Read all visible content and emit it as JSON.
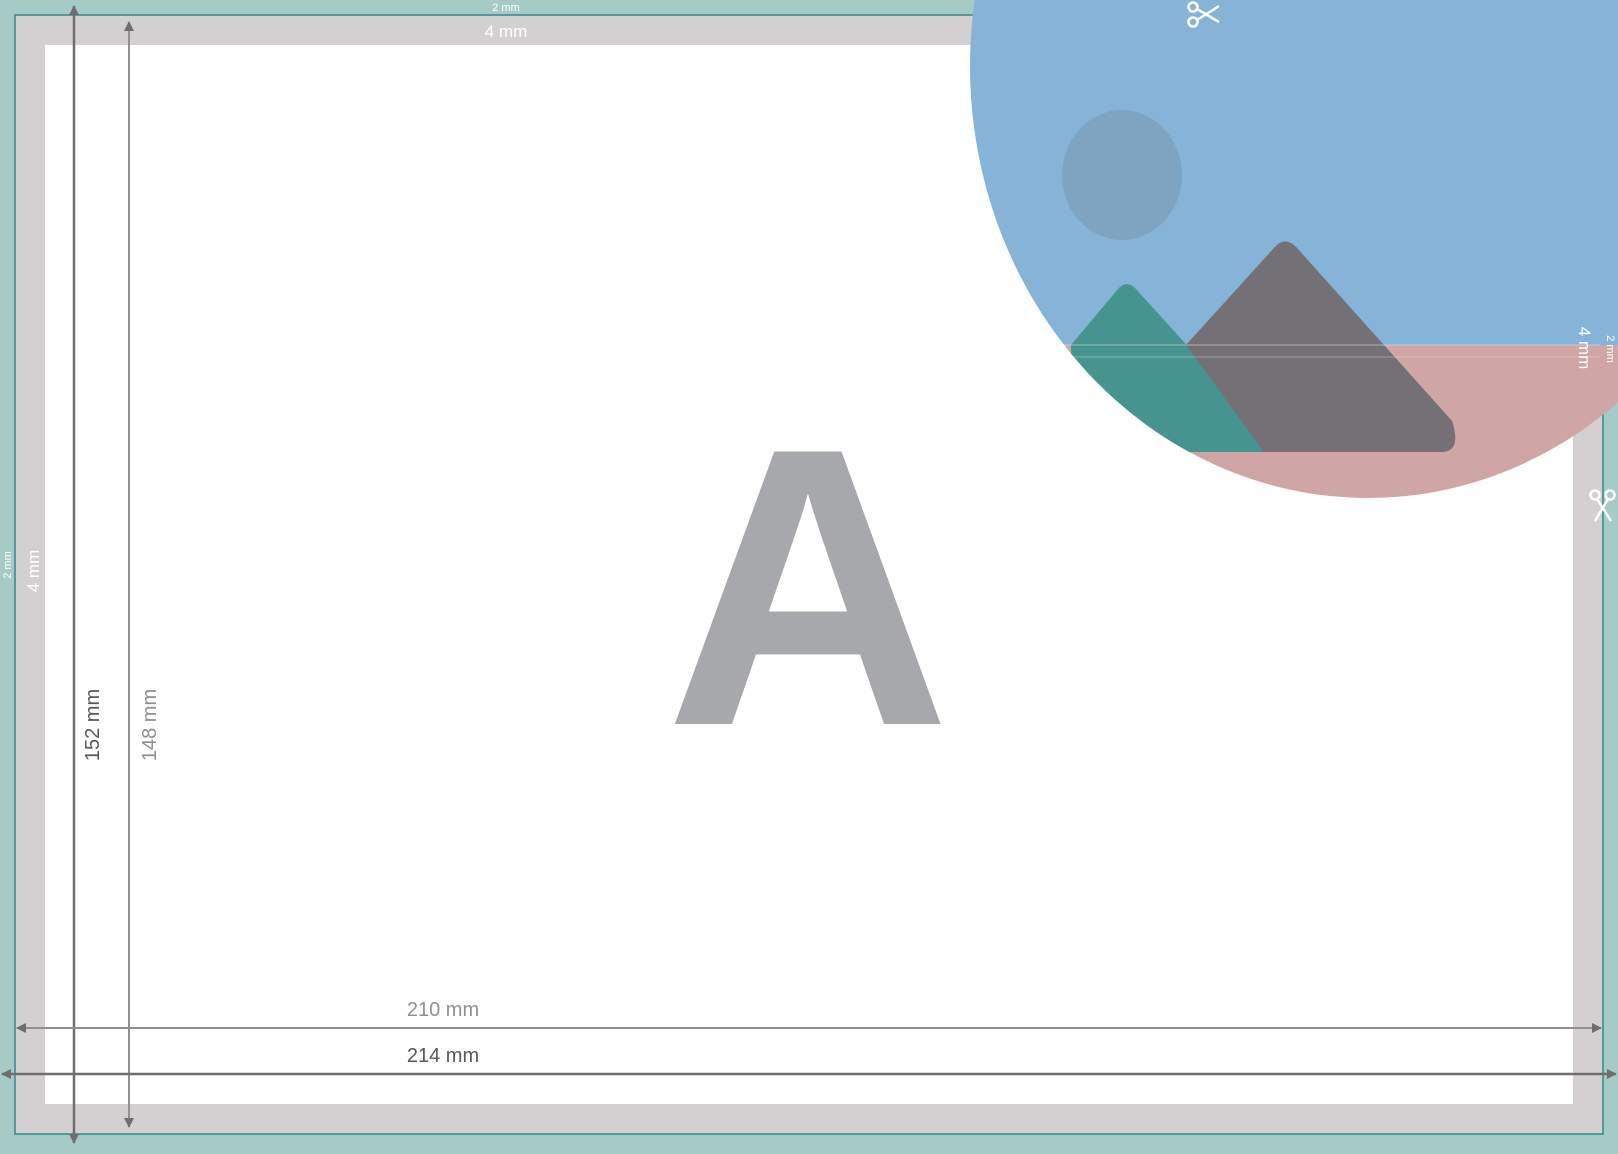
{
  "bleed_outer": "2 mm",
  "bleed_inner": "4 mm",
  "width_trim": "210 mm",
  "width_full": "214 mm",
  "height_full": "152 mm",
  "height_trim": "148 mm",
  "letter": "A",
  "icons": [
    "scissors-icon",
    "image-placeholder-icon"
  ],
  "colors": {
    "outer_bleed": "#a6cbc6",
    "inner_bleed": "#d4d0d1",
    "page": "#ffffff",
    "cut_line": "#2f8a86",
    "dark_arrow": "#6d6e70",
    "light_arrow": "#8f9092",
    "letter": "#a7a8ab",
    "sky": "#86b4d9",
    "ground": "#cfa6a5",
    "sun": "#7ea4c2",
    "mountain_small": "#469490",
    "mountain_big": "#737175"
  }
}
